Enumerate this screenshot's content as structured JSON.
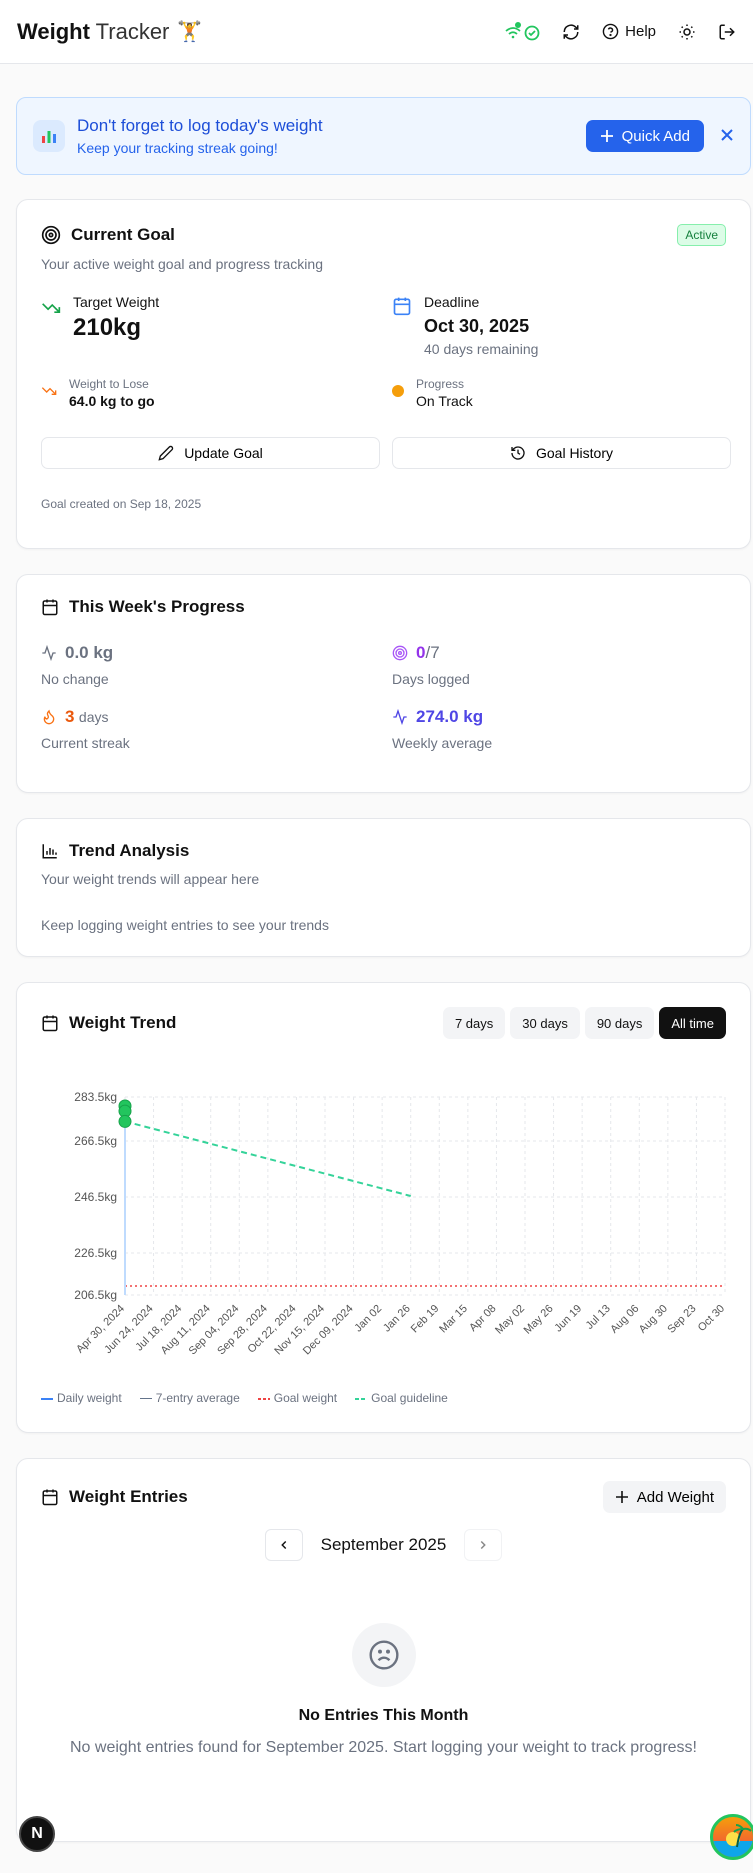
{
  "header": {
    "title_bold": "Weight",
    "title_rest": "Tracker",
    "brand_emoji": "🏋",
    "help_label": "Help"
  },
  "banner": {
    "title": "Don't forget to log today's weight",
    "subtitle": "Keep your tracking streak going!",
    "quick_add_label": "Quick Add"
  },
  "goal": {
    "title": "Current Goal",
    "badge": "Active",
    "description": "Your active weight goal and progress tracking",
    "target_label": "Target Weight",
    "target_value": "210kg",
    "deadline_label": "Deadline",
    "deadline_value": "Oct 30, 2025",
    "days_remaining": "40 days remaining",
    "to_lose_label": "Weight to Lose",
    "to_lose_value": "64.0 kg to go",
    "progress_label": "Progress",
    "progress_value": "On Track",
    "update_label": "Update Goal",
    "history_label": "Goal History",
    "created": "Goal created on Sep 18, 2025"
  },
  "week": {
    "title": "This Week's Progress",
    "change_value": "0.0 kg",
    "change_label": "No change",
    "days_logged_value": "0",
    "days_logged_total": "/7",
    "days_logged_label": "Days logged",
    "streak_value": "3",
    "streak_unit": "days",
    "streak_label": "Current streak",
    "avg_value": "274.0 kg",
    "avg_label": "Weekly average"
  },
  "trend": {
    "title": "Trend Analysis",
    "subtitle": "Your weight trends will appear here",
    "message": "Keep logging weight entries to see your trends"
  },
  "chart": {
    "title": "Weight Trend",
    "ranges": [
      "7 days",
      "30 days",
      "90 days",
      "All time"
    ],
    "active_range": "All time",
    "legend": [
      "Daily weight",
      "7-entry average",
      "Goal weight",
      "Goal guideline"
    ]
  },
  "chart_data": {
    "type": "line",
    "x": [
      "Apr 30, 2024",
      "Jun 24, 2024",
      "Jul 18, 2024",
      "Aug 11, 2024",
      "Sep 04, 2024",
      "Sep 28, 2024",
      "Oct 22, 2024",
      "Nov 15, 2024",
      "Dec 09, 2024",
      "Jan 02",
      "Jan 26",
      "Feb 19",
      "Mar 15",
      "Apr 08",
      "May 02",
      "May 26",
      "Jun 19",
      "Jul 13",
      "Aug 06",
      "Aug 30",
      "Sep 23",
      "Oct 30"
    ],
    "y_ticks": [
      "283.5kg",
      "266.5kg",
      "246.5kg",
      "226.5kg",
      "206.5kg"
    ],
    "ylim": [
      206.5,
      283.5
    ],
    "series": [
      {
        "name": "Daily weight",
        "color": "#22c55e",
        "points": [
          [
            0,
            280
          ],
          [
            0,
            278
          ],
          [
            0,
            274
          ]
        ]
      },
      {
        "name": "Goal weight",
        "color": "#ef4444",
        "value": 210
      },
      {
        "name": "Goal guideline",
        "color": "#34d399",
        "points": [
          [
            0,
            274
          ],
          [
            10,
            245
          ]
        ]
      }
    ],
    "grid": true,
    "legend_position": "bottom-left"
  },
  "entries": {
    "title": "Weight Entries",
    "add_label": "Add Weight",
    "month": "September 2025",
    "empty_title": "No Entries This Month",
    "empty_message": "No weight entries found for September 2025. Start logging your weight to track progress!"
  },
  "fab": {
    "n_label": "N"
  }
}
